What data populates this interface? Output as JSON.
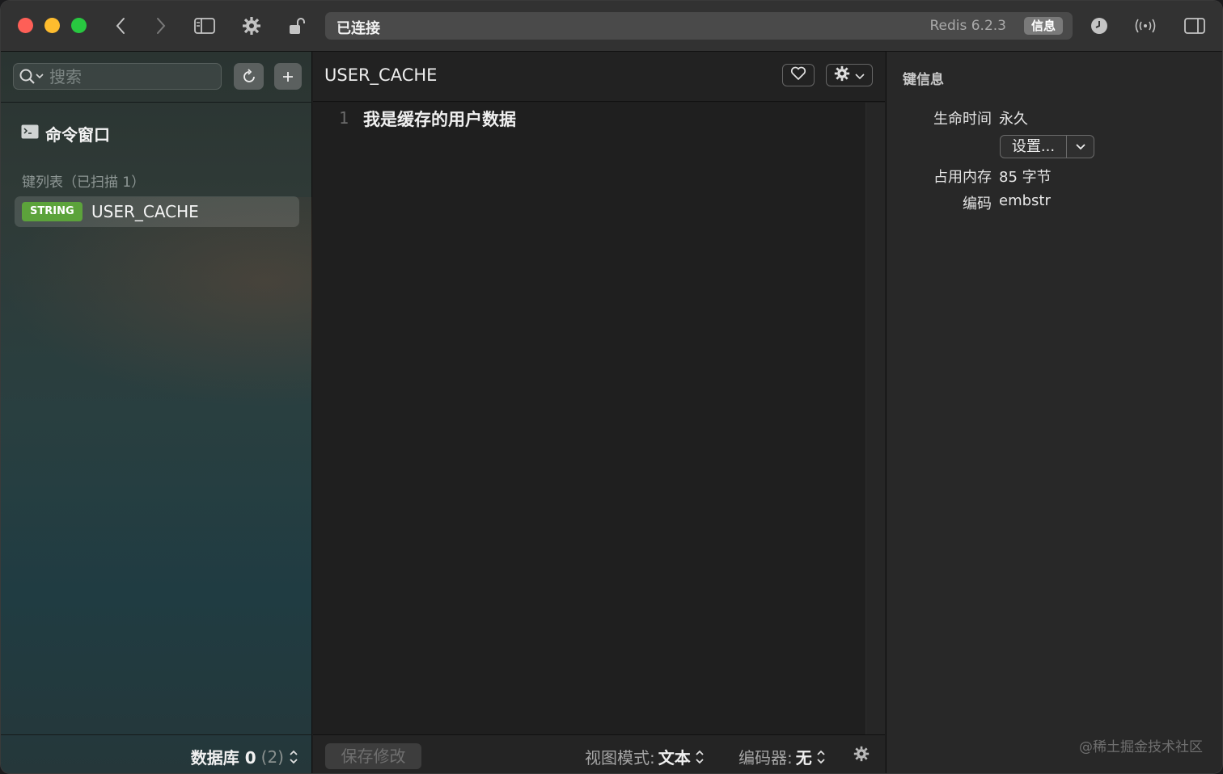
{
  "titlebar": {
    "status": "已连接",
    "version": "Redis 6.2.3",
    "info_pill": "信息"
  },
  "sidebar": {
    "search_placeholder": "搜索",
    "command_window_label": "命令窗口",
    "keylist_title": "键列表（已扫描 1）",
    "keys": [
      {
        "type": "STRING",
        "name": "USER_CACHE"
      }
    ],
    "db_label": "数据库 0",
    "db_count": "(2)"
  },
  "editor": {
    "key_title": "USER_CACHE",
    "lines": [
      {
        "number": "1",
        "text": "我是缓存的用户数据"
      }
    ],
    "save_label": "保存修改",
    "view_mode_label": "视图模式:",
    "view_mode_value": "文本",
    "encoder_label": "编码器:",
    "encoder_value": "无"
  },
  "inspector": {
    "title": "键信息",
    "ttl_label": "生命时间",
    "ttl_value": "永久",
    "set_button": "设置...",
    "memory_label": "占用内存",
    "memory_value": "85 字节",
    "encoding_label": "编码",
    "encoding_value": "embstr"
  },
  "watermark": "@稀土掘金技术社区",
  "colors": {
    "string_badge": "#5ca33b",
    "close": "#fe5f57",
    "minimize": "#febc2e",
    "zoom": "#28c840"
  }
}
